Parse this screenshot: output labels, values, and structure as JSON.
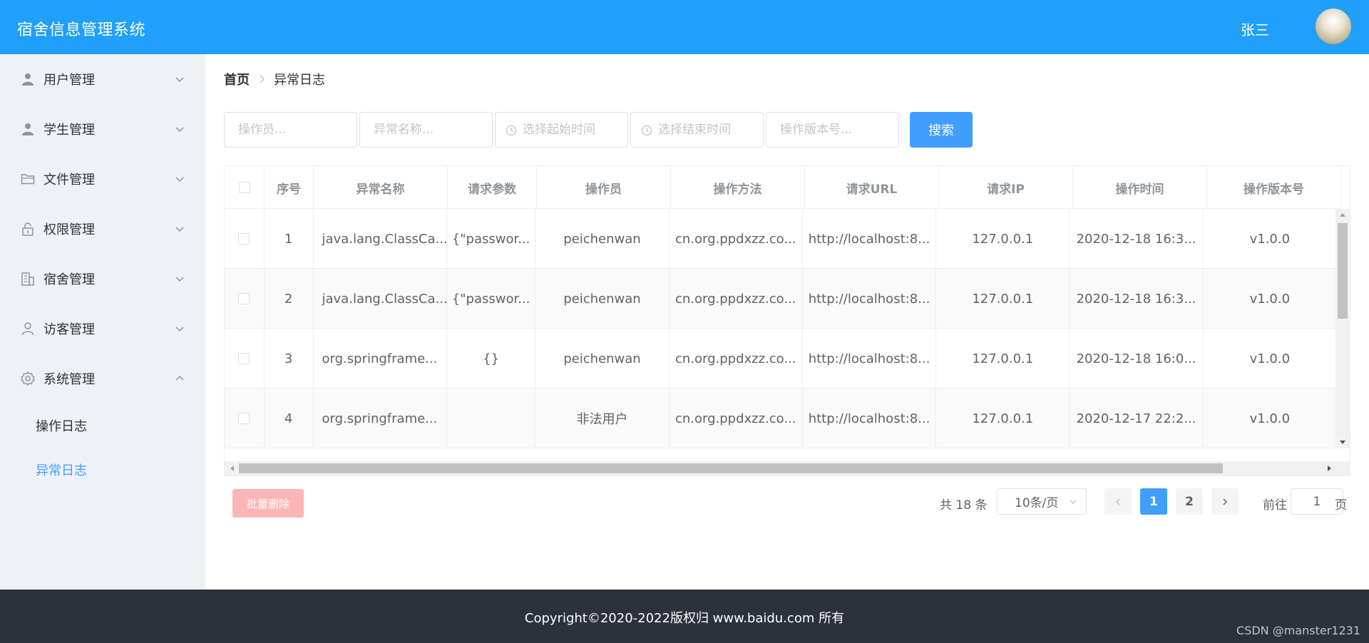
{
  "header": {
    "title": "宿舍信息管理系统",
    "username": "张三"
  },
  "sidebar": {
    "items": [
      {
        "label": "用户管理",
        "icon": "user-icon"
      },
      {
        "label": "学生管理",
        "icon": "user-icon"
      },
      {
        "label": "文件管理",
        "icon": "folder-icon"
      },
      {
        "label": "权限管理",
        "icon": "lock-icon"
      },
      {
        "label": "宿舍管理",
        "icon": "building-icon"
      },
      {
        "label": "访客管理",
        "icon": "user-outline-icon"
      },
      {
        "label": "系统管理",
        "icon": "gear-icon",
        "expanded": true
      }
    ],
    "subitems": [
      {
        "label": "操作日志",
        "active": false
      },
      {
        "label": "异常日志",
        "active": true
      }
    ]
  },
  "breadcrumb": {
    "home": "首页",
    "current": "异常日志"
  },
  "filters": {
    "operator_placeholder": "操作员...",
    "exception_placeholder": "异常名称...",
    "start_time_placeholder": "选择起始时间",
    "end_time_placeholder": "选择结束时间",
    "version_placeholder": "操作版本号...",
    "search_label": "搜索"
  },
  "table": {
    "headers": [
      "序号",
      "异常名称",
      "请求参数",
      "操作员",
      "操作方法",
      "请求URL",
      "请求IP",
      "操作时间",
      "操作版本号"
    ],
    "rows": [
      [
        "1",
        "java.lang.ClassCa...",
        "{\"passwor...",
        "peichenwan",
        "cn.org.ppdxzz.co...",
        "http://localhost:8...",
        "127.0.0.1",
        "2020-12-18 16:3...",
        "v1.0.0"
      ],
      [
        "2",
        "java.lang.ClassCa...",
        "{\"passwor...",
        "peichenwan",
        "cn.org.ppdxzz.co...",
        "http://localhost:8...",
        "127.0.0.1",
        "2020-12-18 16:3...",
        "v1.0.0"
      ],
      [
        "3",
        "org.springframe...",
        "{}",
        "peichenwan",
        "cn.org.ppdxzz.co...",
        "http://localhost:8...",
        "127.0.0.1",
        "2020-12-18 16:0...",
        "v1.0.0"
      ],
      [
        "4",
        "org.springframe...",
        "",
        "非法用户",
        "cn.org.ppdxzz.co...",
        "http://localhost:8...",
        "127.0.0.1",
        "2020-12-17 22:2...",
        "v1.0.0"
      ]
    ]
  },
  "pagination": {
    "batch_delete_label": "批量删除",
    "total_text": "共 18 条",
    "page_size": "10条/页",
    "pages": [
      "1",
      "2"
    ],
    "current_page": "1",
    "goto_prefix": "前往",
    "goto_value": "1",
    "goto_suffix": "页"
  },
  "footer": {
    "copyright": "Copyright©2020-2022版权归 www.baidu.com 所有",
    "watermark": "CSDN @manster1231"
  }
}
